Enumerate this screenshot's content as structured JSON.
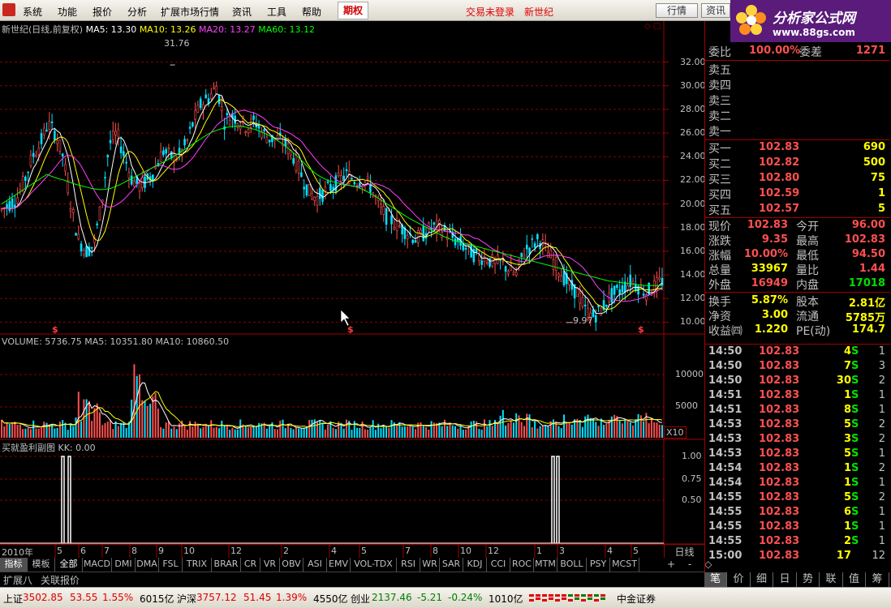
{
  "menu": {
    "items": [
      "系统",
      "功能",
      "报价",
      "分析",
      "扩展市场行情",
      "资讯",
      "工具",
      "帮助"
    ],
    "options_tab": "期权",
    "login_status": "交易未登录",
    "stock_name": "新世纪",
    "quote_btn": "行情",
    "info_btn": "资讯"
  },
  "logo": {
    "title": "分析家公式网",
    "url": "www.88gs.com"
  },
  "price_chart": {
    "header_name": "新世纪(日线,前复权)",
    "ma5": "MA5: 13.30",
    "ma10": "MA10: 13.26",
    "ma20": "MA20: 13.27",
    "ma60": "MA60: 13.12",
    "high_label": "31.76",
    "low_label": "9.97",
    "y_labels": [
      "32.00",
      "30.00",
      "28.00",
      "26.00",
      "24.00",
      "22.00",
      "20.00",
      "18.00",
      "16.00",
      "14.00",
      "12.00",
      "10.00"
    ],
    "markers": [
      "$",
      "$",
      "$"
    ]
  },
  "volume_chart": {
    "header": "VOLUME: 5736.75",
    "ma5": "MA5: 10351.80",
    "ma10": "MA10: 10860.50",
    "y_labels": [
      "10000",
      "5000"
    ],
    "multiplier": "X10"
  },
  "indicator_chart": {
    "header": "买就盈利副图",
    "value": "KK: 0.00",
    "y_labels": [
      "1.00",
      "0.75",
      "0.50"
    ]
  },
  "time_axis": {
    "labels": [
      "2010年",
      "5",
      "6",
      "7",
      "8",
      "9",
      "10",
      "12",
      "2",
      "4",
      "5",
      "7",
      "8",
      "10",
      "12",
      "1",
      "3",
      "4",
      "5"
    ],
    "period": "日线"
  },
  "chart_data": [
    {
      "type": "line",
      "title": "新世纪(日线,前复权)",
      "series": [
        {
          "name": "MA5",
          "values": [
            19.5,
            20,
            20.5,
            22,
            24,
            25,
            26.8,
            26,
            24,
            20,
            17,
            16,
            16.5,
            20,
            25,
            26,
            24,
            22,
            21.5,
            22,
            23,
            24.5,
            24,
            24,
            25,
            27,
            28.5,
            29,
            30,
            27,
            27.5,
            27,
            26.5,
            27,
            26,
            25.5,
            25.5,
            25,
            24,
            22.5,
            21,
            20.5,
            21,
            21.5,
            22,
            22.5,
            22,
            22,
            21.5,
            20,
            19,
            18.5,
            18,
            17.5,
            17,
            17.5,
            18,
            18,
            17.5,
            17,
            16.5,
            16,
            15.5,
            15.5,
            15,
            15,
            14.5,
            14,
            16,
            16.5,
            17,
            16,
            15,
            14,
            13,
            12.5,
            11,
            10.5,
            11,
            12,
            12.5,
            13,
            13.5,
            13,
            12.5,
            13,
            13.5
          ]
        },
        {
          "name": "MA60",
          "values": [
            20,
            20.5,
            21,
            21.5,
            22,
            22.5,
            22.2,
            22,
            21.7,
            21.5,
            21.3,
            21.2,
            21.3,
            21.6,
            22,
            22.4,
            22.8,
            23.2,
            23.6,
            24,
            24.5,
            25,
            25.5,
            26,
            26.3,
            26.5,
            26.6,
            26.5,
            26.3,
            26,
            25.6,
            25.1,
            24.5,
            23.8,
            23,
            22.4,
            22,
            21.8,
            21.6,
            21.5,
            21.2,
            20.8,
            20.3,
            19.8,
            19.3,
            18.8,
            18.4,
            18,
            17.6,
            17.2,
            16.9,
            16.7,
            16.5,
            16.3,
            16.1,
            15.9,
            15.7,
            15.5,
            15.3,
            15.1,
            14.9,
            14.7,
            14.5,
            14.3,
            14.1,
            13.9,
            13.7,
            13.5,
            13.4,
            13.3,
            13.2,
            13.1,
            13.1,
            13.1
          ]
        }
      ],
      "high": 31.76,
      "low": 9.97,
      "ylim": [
        9,
        33
      ]
    },
    {
      "type": "bar",
      "title": "VOLUME",
      "ylim": [
        0,
        14000
      ]
    },
    {
      "type": "line",
      "title": "买就盈利副图",
      "ylim": [
        0,
        1.2
      ]
    }
  ],
  "order_book": {
    "wb_label": "委比",
    "wb_value": "100.00%",
    "wc_label": "委差",
    "wc_value": "1271",
    "sell": [
      {
        "label": "卖五"
      },
      {
        "label": "卖四"
      },
      {
        "label": "卖三"
      },
      {
        "label": "卖二"
      },
      {
        "label": "卖一"
      }
    ],
    "buy": [
      {
        "label": "买一",
        "price": "102.83",
        "vol": "690"
      },
      {
        "label": "买二",
        "price": "102.82",
        "vol": "500"
      },
      {
        "label": "买三",
        "price": "102.80",
        "vol": "75"
      },
      {
        "label": "买四",
        "price": "102.59",
        "vol": "1"
      },
      {
        "label": "买五",
        "price": "102.57",
        "vol": "5"
      }
    ]
  },
  "quote": [
    {
      "l1": "现价",
      "v1": "102.83",
      "l2": "今开",
      "v2": "96.00",
      "c1": "#ff5050",
      "c2": "#ff5050"
    },
    {
      "l1": "涨跌",
      "v1": "9.35",
      "l2": "最高",
      "v2": "102.83",
      "c1": "#ff5050",
      "c2": "#ff5050"
    },
    {
      "l1": "涨幅",
      "v1": "10.00%",
      "l2": "最低",
      "v2": "94.50",
      "c1": "#ff5050",
      "c2": "#ff5050"
    },
    {
      "l1": "总量",
      "v1": "33967",
      "l2": "量比",
      "v2": "1.44",
      "c1": "#ffff00",
      "c2": "#ff5050"
    },
    {
      "l1": "外盘",
      "v1": "16949",
      "l2": "内盘",
      "v2": "17018",
      "c1": "#ff5050",
      "c2": "#00e000"
    },
    {
      "l1": "换手",
      "v1": "5.87%",
      "l2": "股本",
      "v2": "2.81亿",
      "c1": "#ffff00",
      "c2": "#ffff00"
    },
    {
      "l1": "净资",
      "v1": "3.00",
      "l2": "流通",
      "v2": "5785万",
      "c1": "#ffff00",
      "c2": "#ffff00"
    },
    {
      "l1": "收益㈣",
      "v1": "1.220",
      "l2": "PE(动)",
      "v2": "174.7",
      "c1": "#ffff00",
      "c2": "#ffff00"
    }
  ],
  "ticks": [
    {
      "t": "14:50",
      "p": "102.83",
      "v": "4",
      "s": "S",
      "c": "1"
    },
    {
      "t": "14:50",
      "p": "102.83",
      "v": "7",
      "s": "S",
      "c": "3"
    },
    {
      "t": "14:50",
      "p": "102.83",
      "v": "30",
      "s": "S",
      "c": "2"
    },
    {
      "t": "14:51",
      "p": "102.83",
      "v": "1",
      "s": "S",
      "c": "1"
    },
    {
      "t": "14:51",
      "p": "102.83",
      "v": "8",
      "s": "S",
      "c": "1"
    },
    {
      "t": "14:53",
      "p": "102.83",
      "v": "5",
      "s": "S",
      "c": "2"
    },
    {
      "t": "14:53",
      "p": "102.83",
      "v": "3",
      "s": "S",
      "c": "2"
    },
    {
      "t": "14:53",
      "p": "102.83",
      "v": "5",
      "s": "S",
      "c": "1"
    },
    {
      "t": "14:54",
      "p": "102.83",
      "v": "1",
      "s": "S",
      "c": "2"
    },
    {
      "t": "14:54",
      "p": "102.83",
      "v": "1",
      "s": "S",
      "c": "1"
    },
    {
      "t": "14:55",
      "p": "102.83",
      "v": "5",
      "s": "S",
      "c": "2"
    },
    {
      "t": "14:55",
      "p": "102.83",
      "v": "6",
      "s": "S",
      "c": "1"
    },
    {
      "t": "14:55",
      "p": "102.83",
      "v": "1",
      "s": "S",
      "c": "1"
    },
    {
      "t": "14:55",
      "p": "102.83",
      "v": "2",
      "s": "S",
      "c": "1"
    },
    {
      "t": "15:00",
      "p": "102.83",
      "v": "17",
      "s": "",
      "c": "12"
    }
  ],
  "indicator_tabs": [
    "指标",
    "模板",
    "全部",
    "MACD",
    "DMI",
    "DMA",
    "FSL",
    "TRIX",
    "BRAR",
    "CR",
    "VR",
    "OBV",
    "ASI",
    "EMV",
    "VOL-TDX",
    "RSI",
    "WR",
    "SAR",
    "KDJ",
    "CCI",
    "ROC",
    "MTM",
    "BOLL",
    "PSY",
    "MCST"
  ],
  "subbar": {
    "ext": "扩展八",
    "related": "关联报价",
    "plus": "+",
    "minus": "-",
    "more": "◇"
  },
  "side_tabs": [
    "笔",
    "价",
    "细",
    "日",
    "势",
    "联",
    "值",
    "筹"
  ],
  "status": {
    "sh_label": "上证",
    "sh_idx": "3502.85",
    "sh_chg": "53.55",
    "sh_pct": "1.55%",
    "sh_amt": "6015亿",
    "hs_label": "沪深",
    "hs_idx": "3757.12",
    "hs_chg": "51.45",
    "hs_pct": "1.39%",
    "hs_amt": "4550亿",
    "cy_label": "创业",
    "cy_idx": "2137.46",
    "cy_chg": "-5.21",
    "cy_pct": "-0.24%",
    "cy_amt": "1010亿",
    "broker": "中金证券"
  },
  "colors": {
    "ma5": "#ffffff",
    "ma10": "#ffff00",
    "ma20": "#ff40ff",
    "ma60": "#00ff00",
    "up": "#ff5050",
    "down": "#00e0ff",
    "grid": "#a00000"
  }
}
